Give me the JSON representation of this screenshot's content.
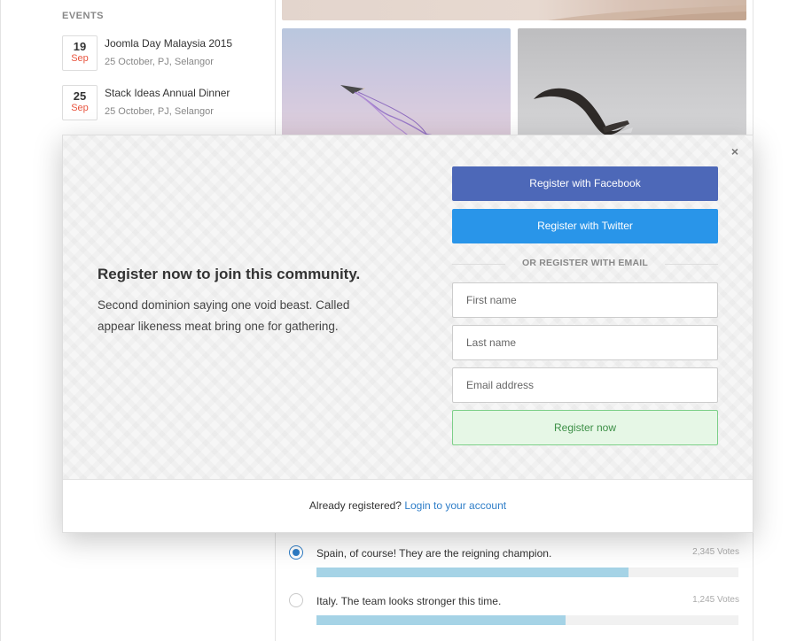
{
  "events": {
    "title": "EVENTS",
    "items": [
      {
        "day": "19",
        "month": "Sep",
        "title": "Joomla Day Malaysia 2015",
        "meta": "25 October, PJ, Selangor"
      },
      {
        "day": "25",
        "month": "Sep",
        "title": "Stack Ideas Annual Dinner",
        "meta": "25 October, PJ, Selangor"
      }
    ]
  },
  "modal": {
    "close_icon": "×",
    "headline": "Register now to join this community.",
    "subtext": "Second dominion saying one void beast. Called appear likeness meat bring one for gathering.",
    "facebook_label": "Register with Facebook",
    "twitter_label": "Register with Twitter",
    "divider_text": "OR REGISTER WITH EMAIL",
    "fields": {
      "first_name_placeholder": "First name",
      "last_name_placeholder": "Last name",
      "email_placeholder": "Email address"
    },
    "register_label": "Register now",
    "footer_text": "Already registered?",
    "footer_link": "Login to your account"
  },
  "poll": {
    "options": [
      {
        "label": "Spain, of course! They are the reigning champion.",
        "votes": "2,345 Votes",
        "fraction": 0.74,
        "selected": true
      },
      {
        "label": "Italy. The team looks stronger this time.",
        "votes": "1,245 Votes",
        "fraction": 0.59,
        "selected": false
      }
    ]
  },
  "colors": {
    "facebook": "#4d68b8",
    "twitter": "#2995e9",
    "register_bg": "#e6f7e6",
    "register_border": "#7ccf88",
    "link": "#2f7ec8",
    "event_month": "#e8543f",
    "poll_bar": "#a5d3e6"
  },
  "icons": {
    "close": "close-icon",
    "radio_selected": "radio-selected-icon",
    "radio_unselected": "radio-unselected-icon"
  }
}
